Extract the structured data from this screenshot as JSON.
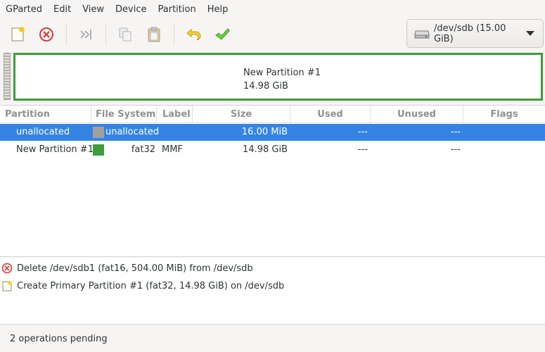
{
  "menubar": {
    "items": [
      "GParted",
      "Edit",
      "View",
      "Device",
      "Partition",
      "Help"
    ]
  },
  "toolbar": {
    "buttons": [
      {
        "name": "new-partition",
        "icon": "new-document-icon"
      },
      {
        "name": "delete-partition",
        "icon": "delete-icon"
      },
      {
        "name": "resize-move",
        "icon": "resize-move-icon"
      },
      {
        "name": "copy",
        "icon": "copy-icon"
      },
      {
        "name": "paste",
        "icon": "paste-icon"
      },
      {
        "name": "undo",
        "icon": "undo-icon"
      },
      {
        "name": "apply",
        "icon": "apply-checkmark-icon"
      }
    ],
    "device": "/dev/sdb (15.00 GiB)"
  },
  "disk_visual": {
    "partition_name": "New Partition #1",
    "partition_size": "14.98 GiB",
    "partition_color": "#3d9e3d"
  },
  "table": {
    "columns": [
      "Partition",
      "File System",
      "Label",
      "Size",
      "Used",
      "Unused",
      "Flags"
    ],
    "rows": [
      {
        "partition": "unallocated",
        "filesystem": "unallocated",
        "label": "",
        "size": "16.00 MiB",
        "used": "---",
        "unused": "---",
        "flags": "",
        "swatch": "#a0a0a0",
        "selected": true
      },
      {
        "partition": "New Partition #1",
        "filesystem": "fat32",
        "label": "MMF",
        "size": "14.98 GiB",
        "used": "---",
        "unused": "---",
        "flags": "",
        "swatch": "#3d9e3d",
        "selected": false
      }
    ]
  },
  "operations": [
    {
      "icon": "delete-icon",
      "text": "Delete /dev/sdb1 (fat16, 504.00 MiB) from /dev/sdb"
    },
    {
      "icon": "new-document-icon",
      "text": "Create Primary Partition #1 (fat32, 14.98 GiB) on /dev/sdb"
    }
  ],
  "status": "2 operations pending",
  "colors": {
    "selection": "#3584e4",
    "fat32": "#3d9e3d",
    "unallocated": "#a0a0a0"
  }
}
